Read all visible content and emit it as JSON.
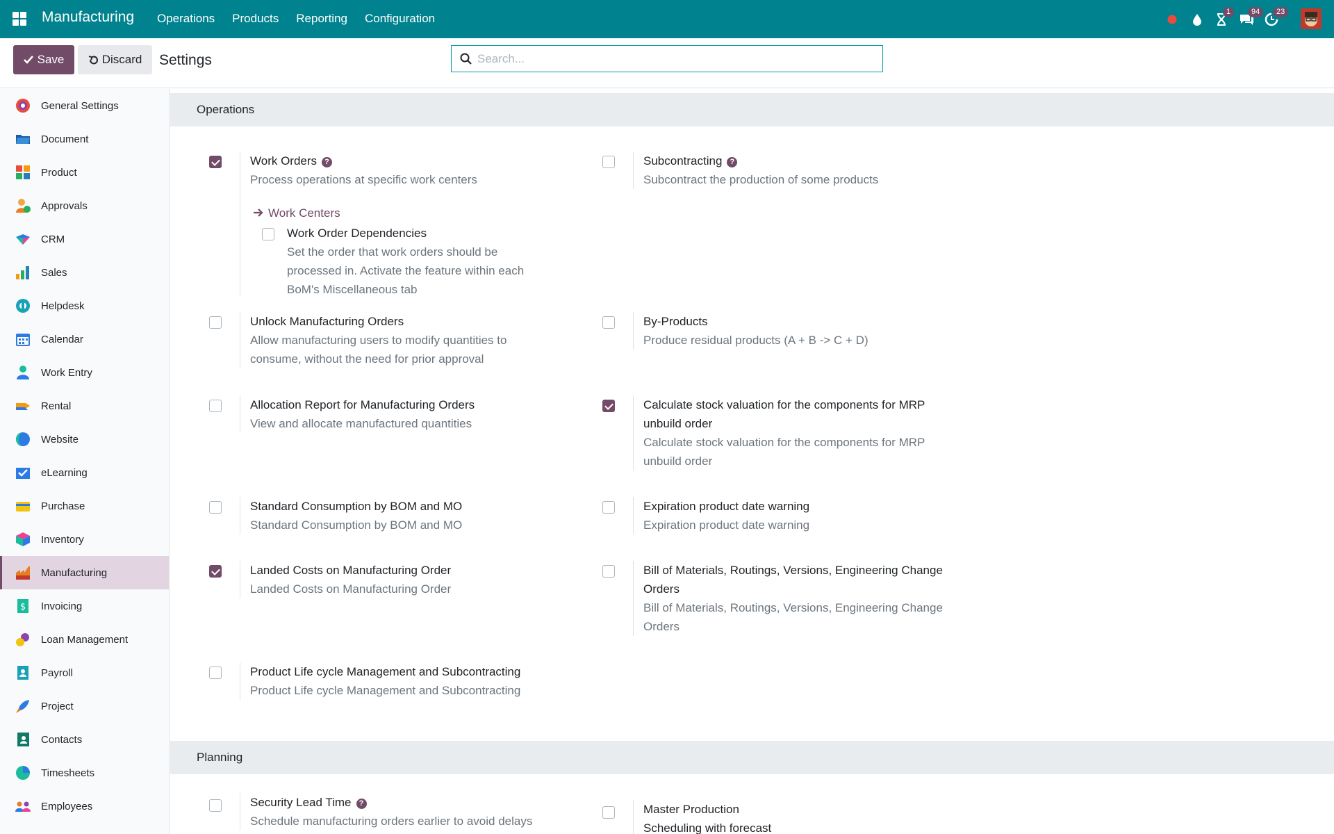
{
  "navbar": {
    "app_name": "Manufacturing",
    "menu": [
      "Operations",
      "Products",
      "Reporting",
      "Configuration"
    ],
    "badges": {
      "activities": "1",
      "messages": "94",
      "updates": "23"
    }
  },
  "control": {
    "save_label": "Save",
    "discard_label": "Discard",
    "title": "Settings",
    "search_placeholder": "Search..."
  },
  "sidebar": {
    "items": [
      {
        "label": "General Settings",
        "icon": "settings-icon"
      },
      {
        "label": "Document",
        "icon": "folder-icon"
      },
      {
        "label": "Product",
        "icon": "product-icon"
      },
      {
        "label": "Approvals",
        "icon": "approvals-icon"
      },
      {
        "label": "CRM",
        "icon": "crm-icon"
      },
      {
        "label": "Sales",
        "icon": "sales-icon"
      },
      {
        "label": "Helpdesk",
        "icon": "helpdesk-icon"
      },
      {
        "label": "Calendar",
        "icon": "calendar-icon"
      },
      {
        "label": "Work Entry",
        "icon": "work-entry-icon"
      },
      {
        "label": "Rental",
        "icon": "rental-icon"
      },
      {
        "label": "Website",
        "icon": "website-icon"
      },
      {
        "label": "eLearning",
        "icon": "elearning-icon"
      },
      {
        "label": "Purchase",
        "icon": "purchase-icon"
      },
      {
        "label": "Inventory",
        "icon": "inventory-icon"
      },
      {
        "label": "Manufacturing",
        "icon": "manufacturing-icon"
      },
      {
        "label": "Invoicing",
        "icon": "invoicing-icon"
      },
      {
        "label": "Loan Management",
        "icon": "loan-icon"
      },
      {
        "label": "Payroll",
        "icon": "payroll-icon"
      },
      {
        "label": "Project",
        "icon": "project-icon"
      },
      {
        "label": "Contacts",
        "icon": "contacts-icon"
      },
      {
        "label": "Timesheets",
        "icon": "timesheets-icon"
      },
      {
        "label": "Employees",
        "icon": "employees-icon"
      }
    ],
    "active": "Manufacturing"
  },
  "operations": {
    "title": "Operations",
    "work_orders": {
      "label": "Work Orders",
      "desc": "Process operations at specific work centers",
      "checked": true,
      "link": "Work Centers"
    },
    "work_order_dependencies": {
      "label": "Work Order Dependencies",
      "desc_lines": [
        "Set the order that work orders should be",
        "processed in. Activate the feature within each",
        "BoM's Miscellaneous tab"
      ],
      "checked": false
    },
    "subcontracting": {
      "label": "Subcontracting",
      "desc": "Subcontract the production of some products",
      "checked": false
    },
    "unlock_mo": {
      "label": "Unlock Manufacturing Orders",
      "desc_lines": [
        "Allow manufacturing users to modify quantities to",
        "consume, without the need for prior approval"
      ],
      "checked": false
    },
    "byproducts": {
      "label": "By-Products",
      "desc": "Produce residual products (A + B -> C + D)",
      "checked": false
    },
    "allocation": {
      "label": "Allocation Report for Manufacturing Orders",
      "desc": "View and allocate manufactured quantities",
      "checked": false
    },
    "stock_valuation": {
      "label_lines": [
        "Calculate stock valuation for the components for MRP",
        "unbuild order"
      ],
      "desc_lines": [
        "Calculate stock valuation for the components for MRP",
        "unbuild order"
      ],
      "checked": true
    },
    "standard_consumption": {
      "label": "Standard Consumption by BOM and MO",
      "desc": "Standard Consumption by BOM and MO",
      "checked": false
    },
    "expiration": {
      "label": "Expiration product date warning",
      "desc": "Expiration product date warning",
      "checked": false
    },
    "landed_costs": {
      "label": "Landed Costs on Manufacturing Order",
      "desc": "Landed Costs on Manufacturing Order",
      "checked": true
    },
    "bom_versions": {
      "label_lines": [
        "Bill of Materials, Routings, Versions, Engineering Change",
        "Orders"
      ],
      "desc_lines": [
        "Bill of Materials, Routings, Versions, Engineering Change",
        "Orders"
      ],
      "checked": false
    },
    "plm": {
      "label": "Product Life cycle Management and Subcontracting",
      "desc": "Product Life cycle Management and Subcontracting",
      "checked": false
    }
  },
  "planning": {
    "title": "Planning",
    "security_lead": {
      "label": "Security Lead Time",
      "desc": "Schedule manufacturing orders earlier to avoid delays",
      "checked": false
    },
    "master_production": {
      "label": "Master Production",
      "desc": "Scheduling with forecast",
      "checked": false
    }
  }
}
